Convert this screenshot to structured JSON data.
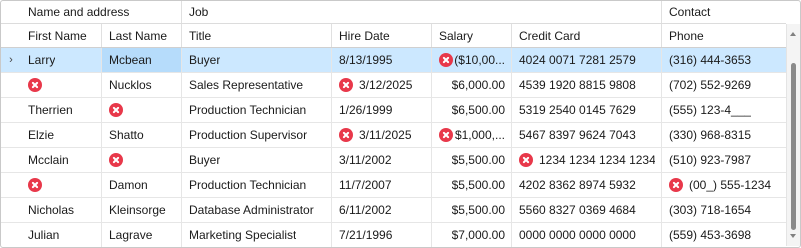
{
  "bands": {
    "name_and_address": "Name and address",
    "job": "Job",
    "contact": "Contact"
  },
  "columns": {
    "first_name": "First Name",
    "last_name": "Last Name",
    "title": "Title",
    "hire_date": "Hire Date",
    "salary": "Salary",
    "credit_card": "Credit Card",
    "phone": "Phone"
  },
  "row_indicator": "›",
  "colors": {
    "selected_row": "#cce8ff",
    "error_icon": "#e8384a",
    "border": "#c9c9c9"
  },
  "rows": [
    {
      "first_name": "Larry",
      "last_name": "Mcbean",
      "title": "Buyer",
      "hire_date": "8/13/1995",
      "salary": "($10,00...",
      "credit_card": "4024 0071 7281 2579",
      "phone": "(316) 444-3653"
    },
    {
      "first_name": "",
      "last_name": "Nucklos",
      "title": "Sales Representative",
      "hire_date": "3/12/2025",
      "salary": "$6,000.00",
      "credit_card": "4539 1920 8815 9808",
      "phone": "(702) 552-9269"
    },
    {
      "first_name": "Therrien",
      "last_name": "",
      "title": "Production Technician",
      "hire_date": "1/26/1999",
      "salary": "$6,500.00",
      "credit_card": "5319 2540 0145 7629",
      "phone": "(555) 123-4___"
    },
    {
      "first_name": "Elzie",
      "last_name": "Shatto",
      "title": "Production Supervisor",
      "hire_date": "3/11/2025",
      "salary": "$1,000,...",
      "credit_card": "5467 8397 9624 7043",
      "phone": "(330) 968-8315"
    },
    {
      "first_name": "Mcclain",
      "last_name": "",
      "title": "Buyer",
      "hire_date": "3/11/2002",
      "salary": "$5,500.00",
      "credit_card": "1234 1234 1234 1234",
      "phone": "(510) 923-7987"
    },
    {
      "first_name": "",
      "last_name": "Damon",
      "title": "Production Technician",
      "hire_date": "11/7/2007",
      "salary": "$5,500.00",
      "credit_card": "4202 8362 8974 5932",
      "phone": "(00_) 555-1234"
    },
    {
      "first_name": "Nicholas",
      "last_name": "Kleinsorge",
      "title": "Database Administrator",
      "hire_date": "6/11/2002",
      "salary": "$5,500.00",
      "credit_card": "5560 8327 0369 4684",
      "phone": "(303) 718-1654"
    },
    {
      "first_name": "Julian",
      "last_name": "Lagrave",
      "title": "Marketing Specialist",
      "hire_date": "7/21/1996",
      "salary": "$7,000.00",
      "credit_card": "0000 0000 0000 0000",
      "phone": "(559) 453-3698"
    }
  ]
}
